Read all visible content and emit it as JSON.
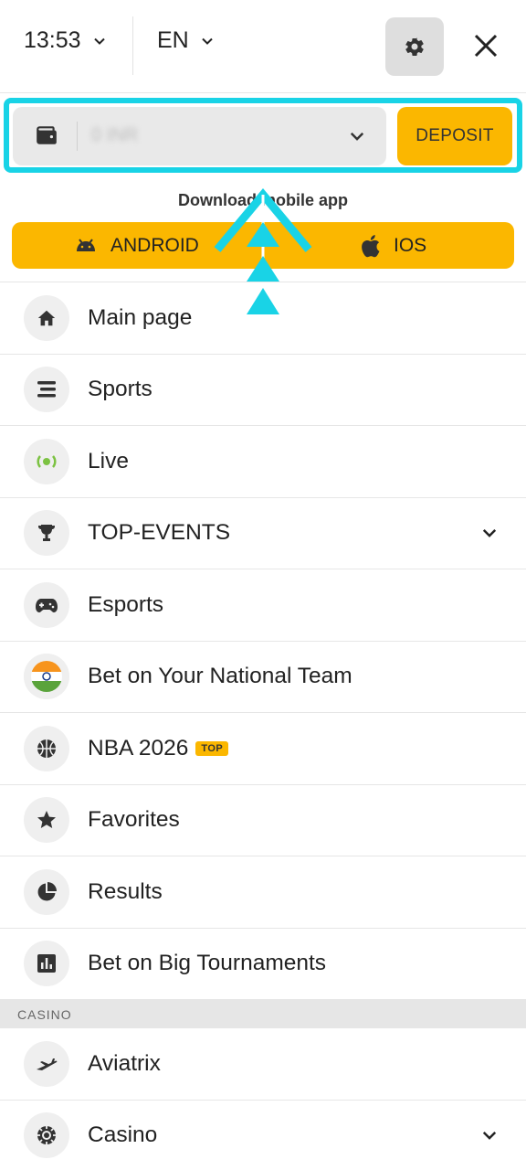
{
  "header": {
    "time": "13:53",
    "language": "EN",
    "settings_icon": "gear-icon",
    "close_icon": "close-icon"
  },
  "wallet": {
    "amount": "0 INR",
    "deposit_label": "DEPOSIT"
  },
  "download": {
    "title": "Download mobile app",
    "android_label": "ANDROID",
    "ios_label": "IOS"
  },
  "menu": {
    "items": [
      {
        "label": "Main page",
        "icon": "home-icon"
      },
      {
        "label": "Sports",
        "icon": "list-icon"
      },
      {
        "label": "Live",
        "icon": "live-icon"
      },
      {
        "label": "TOP-EVENTS",
        "icon": "trophy-icon"
      },
      {
        "label": "Esports",
        "icon": "gamepad-icon"
      },
      {
        "label": "Bet on Your National Team",
        "icon": "india-flag-icon"
      },
      {
        "label": "NBA 2026",
        "icon": "basketball-icon",
        "badge": "TOP"
      },
      {
        "label": "Favorites",
        "icon": "star-icon"
      },
      {
        "label": "Results",
        "icon": "pie-chart-icon"
      },
      {
        "label": "Bet on Big Tournaments",
        "icon": "bar-chart-icon"
      }
    ],
    "casino_header": "CASINO",
    "casino_items": [
      {
        "label": "Aviatrix",
        "icon": "plane-icon"
      },
      {
        "label": "Casino",
        "icon": "casino-chip-icon"
      }
    ]
  },
  "colors": {
    "accent": "#fbb700",
    "highlight": "#19d3e6"
  }
}
